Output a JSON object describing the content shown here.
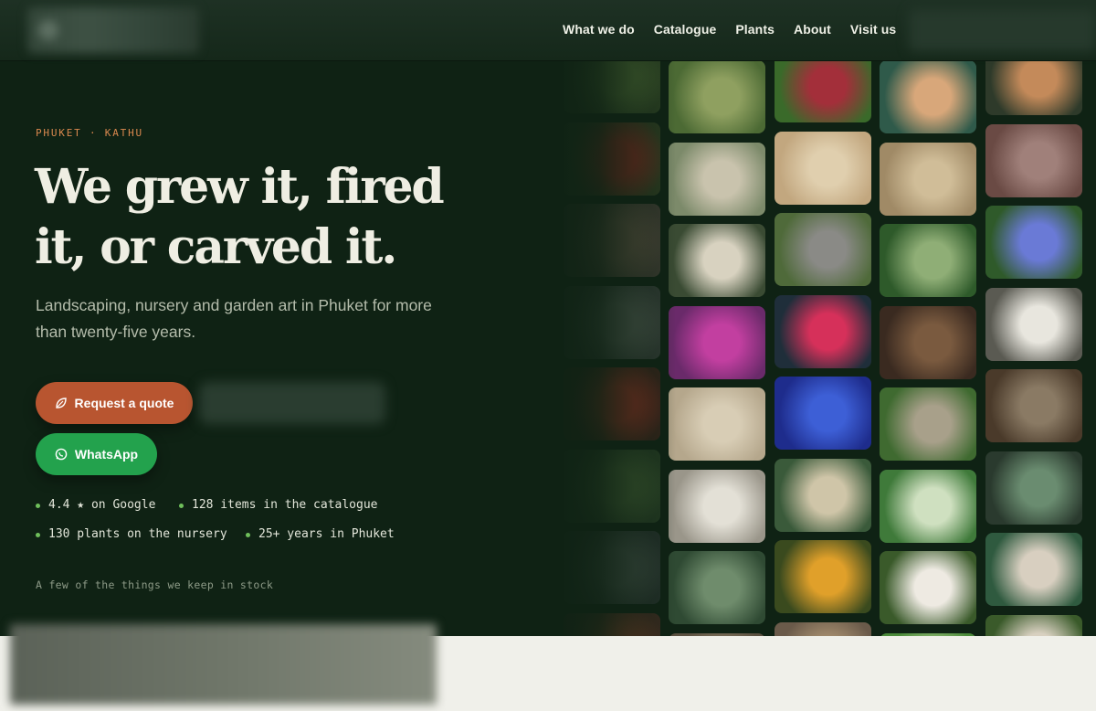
{
  "nav": {
    "items": [
      "What we do",
      "Catalogue",
      "Plants",
      "About",
      "Visit us"
    ]
  },
  "hero": {
    "eyebrow": "PHUKET · KATHU",
    "title_line1": "We grew it, fired",
    "title_line2": "it, or carved it.",
    "subtitle": "Landscaping, nursery and garden art in Phuket for more than twenty-five years.",
    "quote_button": "Request a quote",
    "whatsapp_button": "WhatsApp",
    "stats": [
      "4.4 ★ on Google",
      "128 items in the catalogue",
      "130 plants on the nursery",
      "25+ years in Phuket"
    ],
    "footnote": "A few of the things we keep in stock"
  },
  "colors": {
    "background": "#0f2214",
    "accent_orange": "#b85530",
    "whatsapp_green": "#23a24d",
    "eyebrow": "#d9884e",
    "bullet": "#6fbf5b"
  },
  "icons": {
    "quote": "leaf-icon",
    "whatsapp": "whatsapp-icon"
  },
  "gallery": [
    {
      "name": "tile-plant-leaves",
      "col": 0,
      "row": 0
    },
    {
      "name": "tile-heliconia",
      "col": 0,
      "row": 1
    },
    {
      "name": "tile-ceramic-pot",
      "col": 0,
      "row": 2
    },
    {
      "name": "tile-grey-pot",
      "col": 0,
      "row": 3
    },
    {
      "name": "tile-red-heliconia",
      "col": 0,
      "row": 4
    },
    {
      "name": "tile-shrubs",
      "col": 0,
      "row": 5
    },
    {
      "name": "tile-dark-pot",
      "col": 0,
      "row": 6
    },
    {
      "name": "tile-red-leaves",
      "col": 0,
      "row": 7
    },
    {
      "name": "tile-green-foliage",
      "col": 1,
      "row": 0
    },
    {
      "name": "tile-stone-statue",
      "col": 1,
      "row": 1
    },
    {
      "name": "tile-stone-lanterns",
      "col": 1,
      "row": 2
    },
    {
      "name": "tile-bougainvillea",
      "col": 1,
      "row": 3
    },
    {
      "name": "tile-carved-stone",
      "col": 1,
      "row": 4
    },
    {
      "name": "tile-pebble-panel",
      "col": 1,
      "row": 5
    },
    {
      "name": "tile-cactus",
      "col": 1,
      "row": 6
    },
    {
      "name": "tile-bowl",
      "col": 1,
      "row": 7
    },
    {
      "name": "tile-flowers-bed",
      "col": 2,
      "row": 0
    },
    {
      "name": "tile-relief-panel",
      "col": 2,
      "row": 1
    },
    {
      "name": "tile-statue-garden",
      "col": 2,
      "row": 2
    },
    {
      "name": "tile-banana-flower",
      "col": 2,
      "row": 3
    },
    {
      "name": "tile-blue-pot",
      "col": 2,
      "row": 4
    },
    {
      "name": "tile-glazed-pots",
      "col": 2,
      "row": 5
    },
    {
      "name": "tile-papaya",
      "col": 2,
      "row": 6
    },
    {
      "name": "tile-carved-relief",
      "col": 2,
      "row": 7
    },
    {
      "name": "tile-terracotta-bowl",
      "col": 3,
      "row": 0
    },
    {
      "name": "tile-carved-wall",
      "col": 3,
      "row": 1
    },
    {
      "name": "tile-palms",
      "col": 3,
      "row": 2
    },
    {
      "name": "tile-brown-pots",
      "col": 3,
      "row": 3
    },
    {
      "name": "tile-stone-planter",
      "col": 3,
      "row": 4
    },
    {
      "name": "tile-caladium",
      "col": 3,
      "row": 5
    },
    {
      "name": "tile-white-lantern",
      "col": 3,
      "row": 6
    },
    {
      "name": "tile-green-tall",
      "col": 3,
      "row": 7
    },
    {
      "name": "tile-clay-pots",
      "col": 4,
      "row": 0
    },
    {
      "name": "tile-wood-panel",
      "col": 4,
      "row": 1
    },
    {
      "name": "tile-morning-glory",
      "col": 4,
      "row": 2
    },
    {
      "name": "tile-round-stone",
      "col": 4,
      "row": 3
    },
    {
      "name": "tile-wood-slabs",
      "col": 4,
      "row": 4
    },
    {
      "name": "tile-palm-trees",
      "col": 4,
      "row": 5
    },
    {
      "name": "tile-monkey-statues",
      "col": 4,
      "row": 6
    },
    {
      "name": "tile-stone-post",
      "col": 4,
      "row": 7
    }
  ]
}
